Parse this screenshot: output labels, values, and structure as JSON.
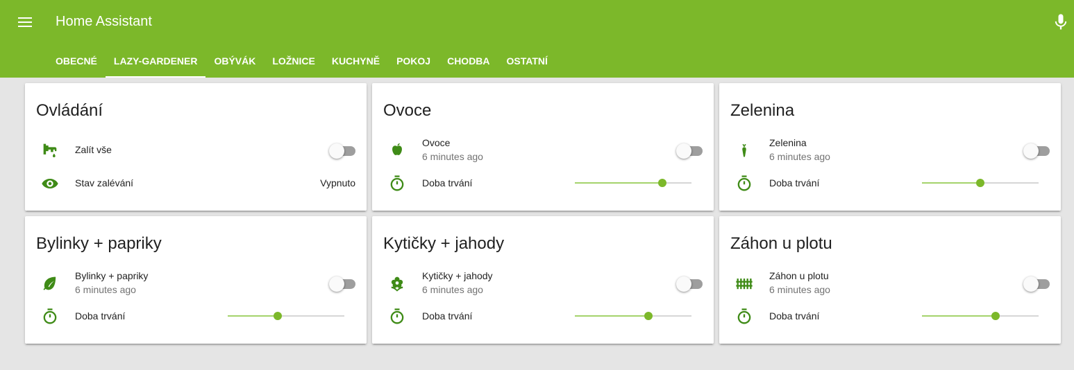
{
  "app": {
    "title": "Home Assistant"
  },
  "icons": {
    "menu": "menu-icon",
    "mic": "microphone-icon",
    "accent": "#7cb82a"
  },
  "tabs": [
    {
      "label": "OBECNÉ",
      "active": false
    },
    {
      "label": "LAZY-GARDENER",
      "active": true
    },
    {
      "label": "OBÝVÁK",
      "active": false
    },
    {
      "label": "LOŽNICE",
      "active": false
    },
    {
      "label": "KUCHYNĚ",
      "active": false
    },
    {
      "label": "POKOJ",
      "active": false
    },
    {
      "label": "CHODBA",
      "active": false
    },
    {
      "label": "OSTATNÍ",
      "active": false
    }
  ],
  "cards": [
    {
      "title": "Ovládání",
      "switch": {
        "label": "Zalít vše",
        "icon": "water-pump-icon",
        "on": false
      },
      "state": {
        "label": "Stav zalévání",
        "icon": "eye-icon",
        "value": "Vypnuto"
      }
    },
    {
      "title": "Ovoce",
      "switch": {
        "label": "Ovoce",
        "secondary": "6 minutes ago",
        "icon": "apple-icon",
        "on": false
      },
      "slider": {
        "label": "Doba trvání",
        "icon": "timer-icon",
        "fraction": 0.75
      }
    },
    {
      "title": "Zelenina",
      "switch": {
        "label": "Zelenina",
        "secondary": "6 minutes ago",
        "icon": "carrot-icon",
        "on": false
      },
      "slider": {
        "label": "Doba trvání",
        "icon": "timer-icon",
        "fraction": 0.5
      }
    },
    {
      "title": "Bylinky + papriky",
      "switch": {
        "label": "Bylinky + papriky",
        "secondary": "6 minutes ago",
        "icon": "leaf-icon",
        "on": false
      },
      "slider": {
        "label": "Doba trvání",
        "icon": "timer-icon",
        "fraction": 0.43
      }
    },
    {
      "title": "Kytičky + jahody",
      "switch": {
        "label": "Kytičky + jahody",
        "secondary": "6 minutes ago",
        "icon": "flower-icon",
        "on": false
      },
      "slider": {
        "label": "Doba trvání",
        "icon": "timer-icon",
        "fraction": 0.63
      }
    },
    {
      "title": "Záhon u plotu",
      "switch": {
        "label": "Záhon u plotu",
        "secondary": "6 minutes ago",
        "icon": "fence-icon",
        "on": false
      },
      "slider": {
        "label": "Doba trvání",
        "icon": "timer-icon",
        "fraction": 0.63
      }
    }
  ]
}
